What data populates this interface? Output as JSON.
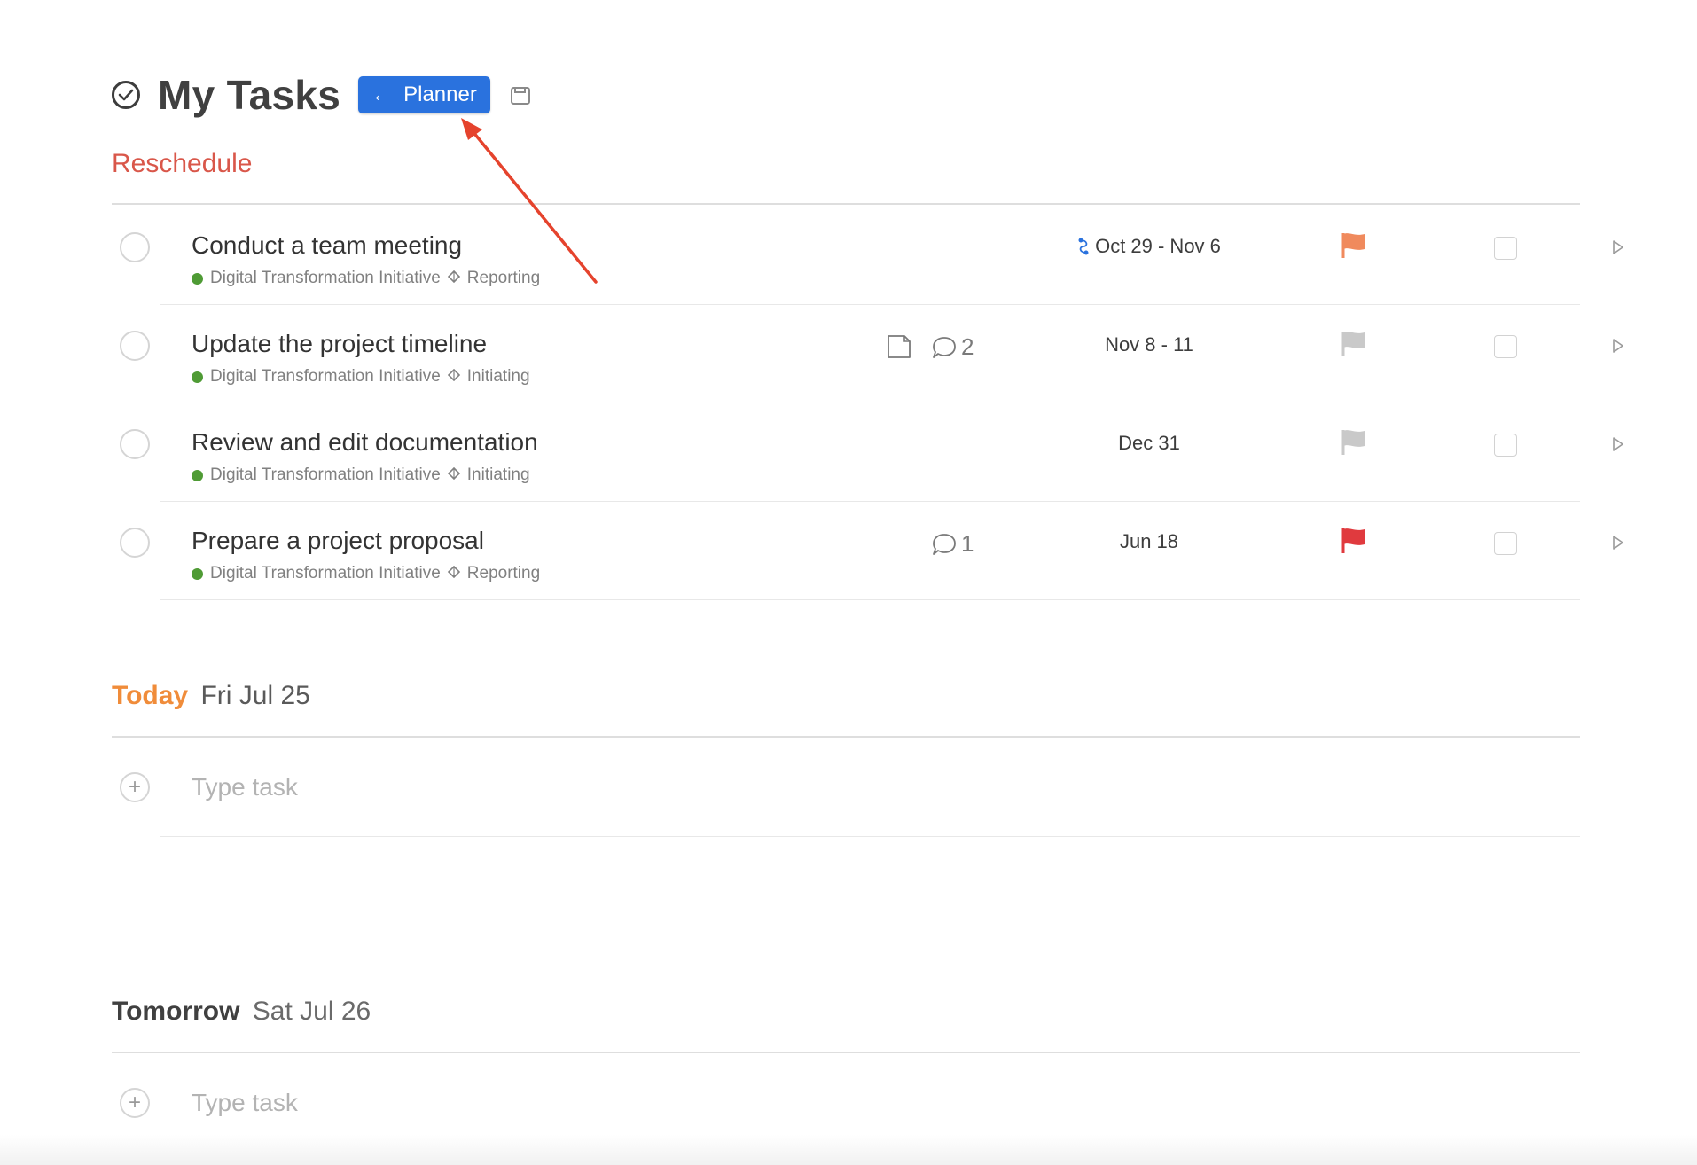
{
  "header": {
    "title": "My Tasks",
    "planner_button_label": "Planner",
    "icons": [
      "check-circle-icon",
      "arrow-left-icon",
      "save-icon"
    ]
  },
  "sections": {
    "reschedule": {
      "title": "Reschedule",
      "color": "#d9574a",
      "tasks": [
        {
          "name": "Conduct a team meeting",
          "project": "Digital Transformation Initiative",
          "phase": "Reporting",
          "has_note": false,
          "comments": "",
          "date": "Oct 29 - Nov 6",
          "recurring": true,
          "flag_color": "#f08a5d"
        },
        {
          "name": "Update the project timeline",
          "project": "Digital Transformation Initiative",
          "phase": "Initiating",
          "has_note": true,
          "comments": "2",
          "date": "Nov 8 - 11",
          "recurring": false,
          "flag_color": "#c9c9c9"
        },
        {
          "name": "Review and edit documentation",
          "project": "Digital Transformation Initiative",
          "phase": "Initiating",
          "has_note": false,
          "comments": "",
          "date": "Dec 31",
          "recurring": false,
          "flag_color": "#c9c9c9"
        },
        {
          "name": "Prepare a project proposal",
          "project": "Digital Transformation Initiative",
          "phase": "Reporting",
          "has_note": false,
          "comments": "1",
          "date": "Jun 18",
          "recurring": false,
          "flag_color": "#e03a3e"
        }
      ]
    },
    "today": {
      "label": "Today",
      "date": "Fri Jul 25",
      "color": "#f08c3a",
      "placeholder": "Type task"
    },
    "tomorrow": {
      "label": "Tomorrow",
      "date": "Sat Jul 26",
      "placeholder": "Type task"
    }
  },
  "colors": {
    "accent_blue": "#2a72de",
    "annotation_arrow": "#e5432d",
    "project_dot": "#4f9b35"
  }
}
